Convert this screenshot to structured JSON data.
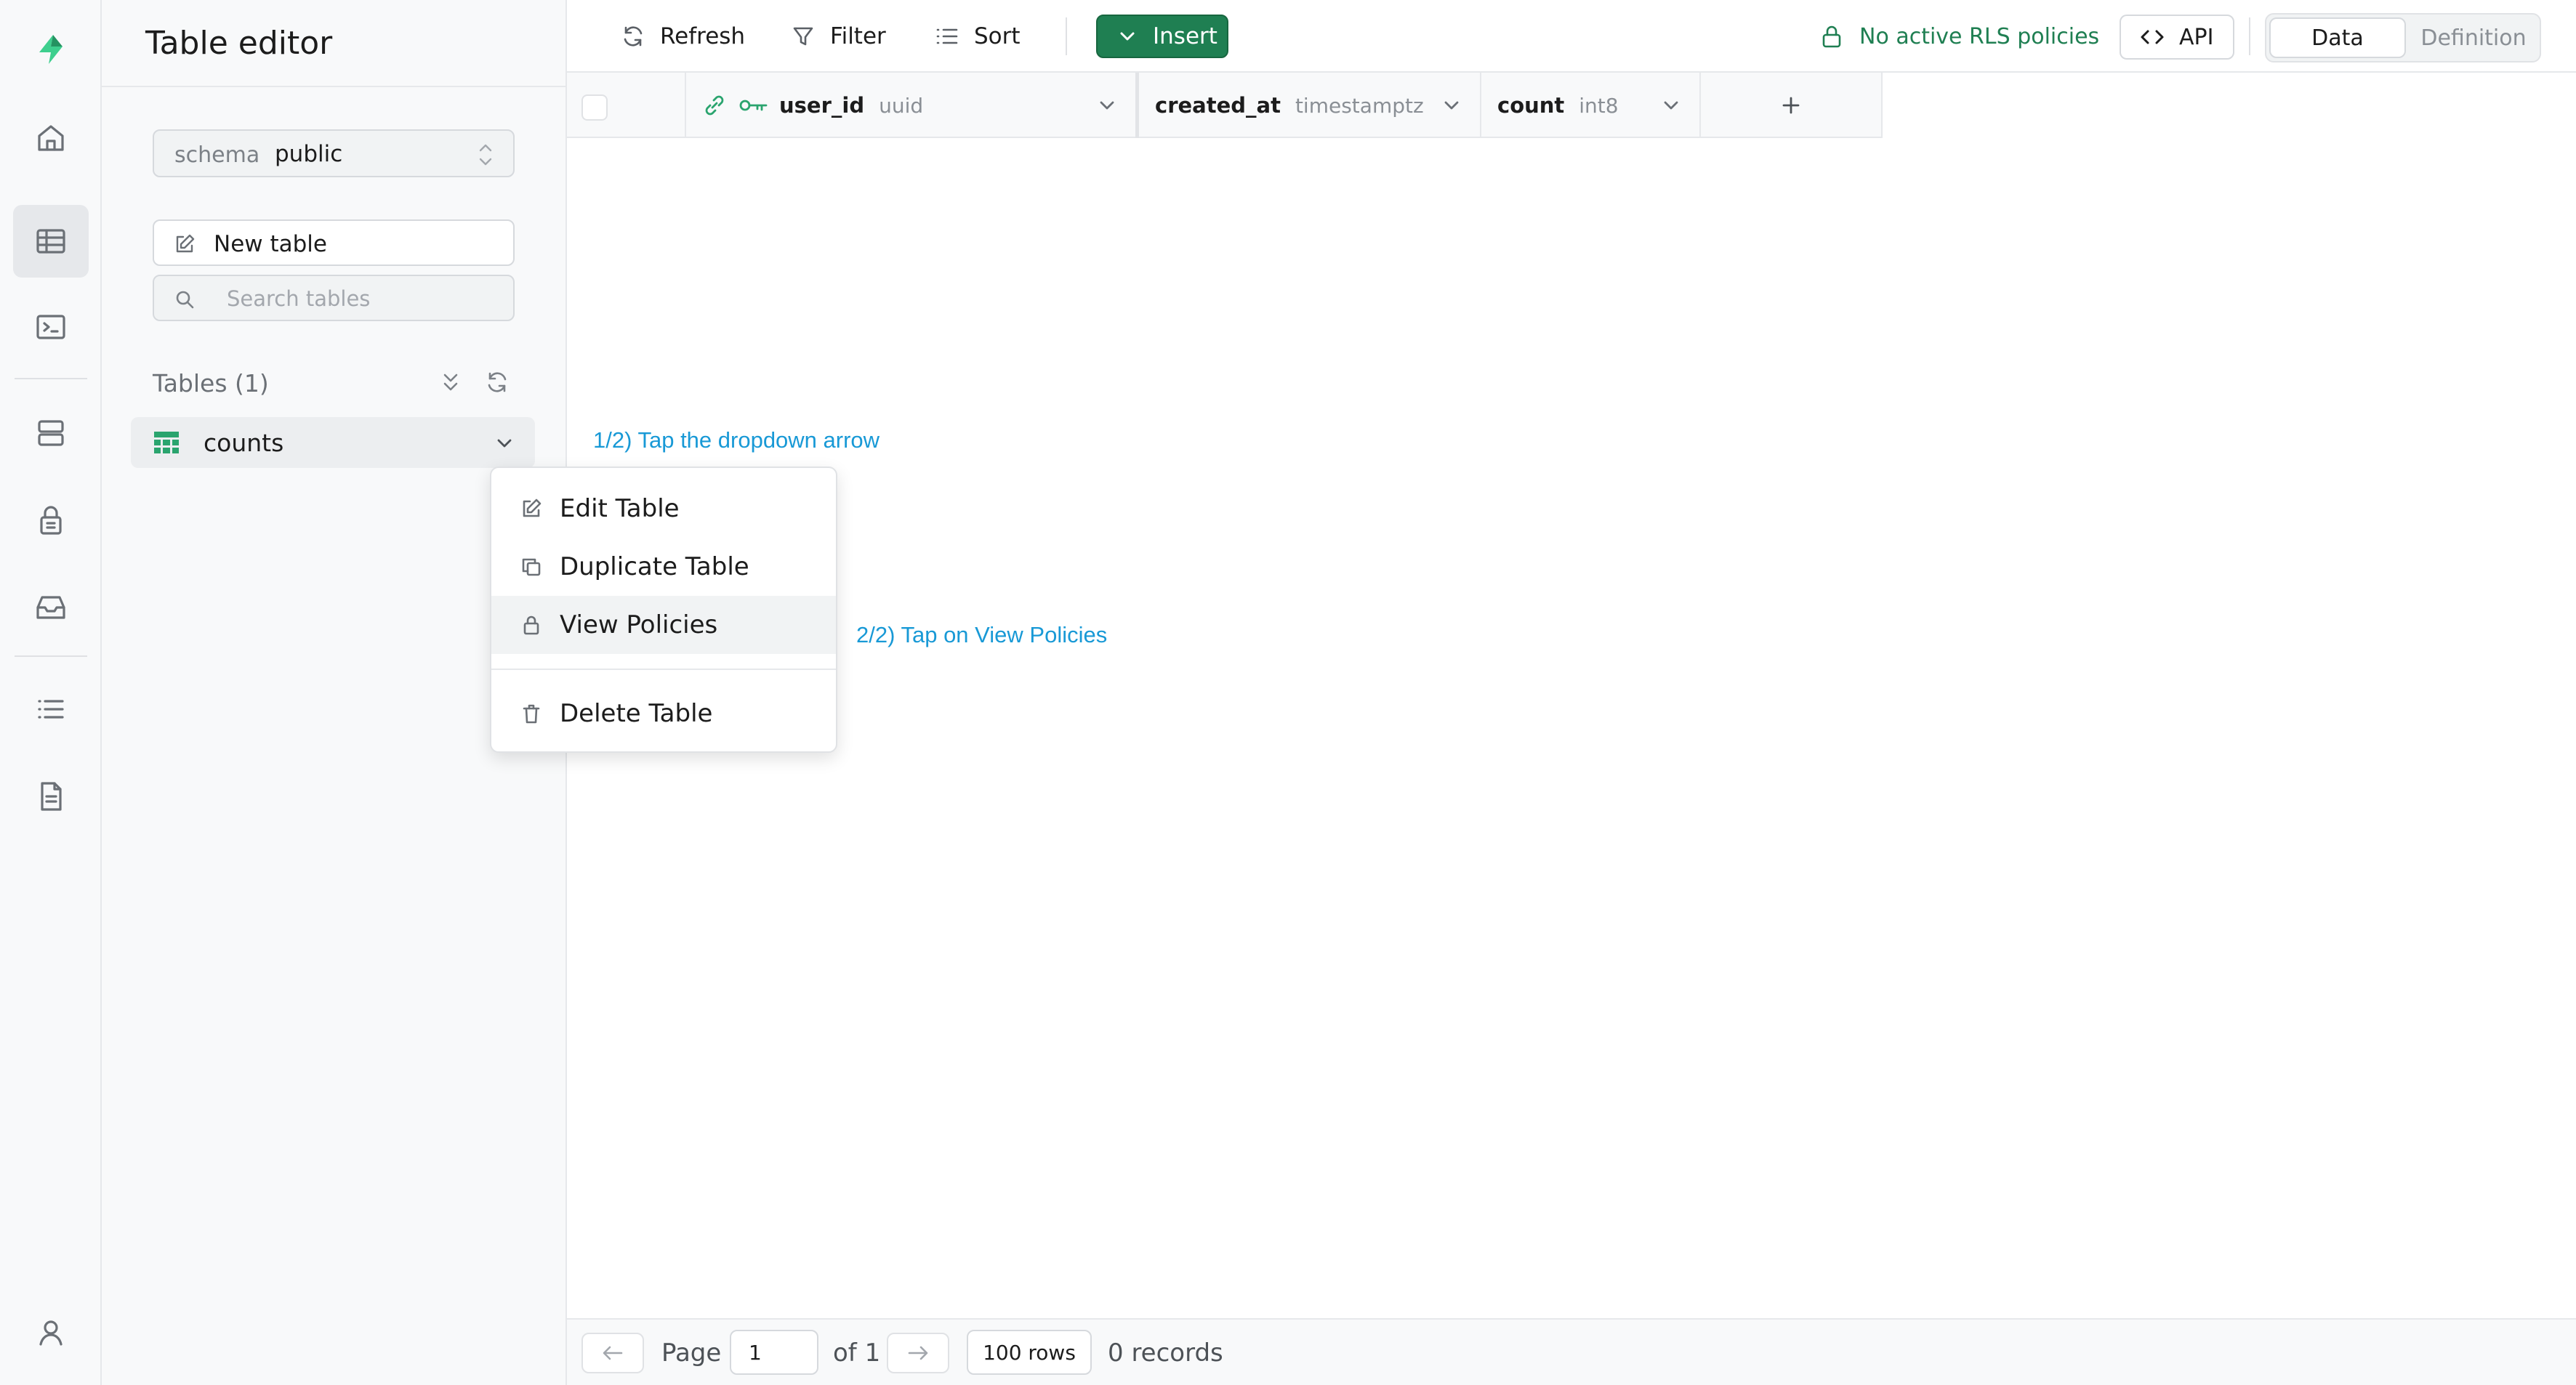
{
  "app": {
    "accent": "#1f7f52",
    "hint_color": "#1899d6"
  },
  "rail": {
    "items": [
      {
        "icon": "supabase-logo-icon"
      },
      {
        "icon": "home-icon"
      },
      {
        "icon": "table-editor-icon",
        "active": true
      },
      {
        "icon": "sql-editor-icon"
      },
      {
        "icon": "database-icon"
      },
      {
        "icon": "auth-lock-icon"
      },
      {
        "icon": "storage-icon"
      },
      {
        "icon": "logs-icon"
      },
      {
        "icon": "docs-icon"
      },
      {
        "icon": "profile-icon"
      }
    ]
  },
  "sidebar": {
    "title": "Table editor",
    "schema_label": "schema",
    "schema_value": "public",
    "new_table_label": "New table",
    "search_placeholder": "Search tables",
    "tables_heading": "Tables (1)",
    "tables": [
      {
        "name": "counts"
      }
    ]
  },
  "toolbar": {
    "refresh_label": "Refresh",
    "filter_label": "Filter",
    "sort_label": "Sort",
    "insert_label": "Insert",
    "rls_status": "No active RLS policies",
    "api_label": "API",
    "view_data_label": "Data",
    "view_definition_label": "Definition"
  },
  "grid": {
    "columns": [
      {
        "name": "user_id",
        "type": "uuid"
      },
      {
        "name": "created_at",
        "type": "timestamptz"
      },
      {
        "name": "count",
        "type": "int8"
      }
    ]
  },
  "hints": {
    "step1": "1/2) Tap the dropdown arrow",
    "step2": "2/2) Tap on View Policies"
  },
  "context_menu": {
    "edit": "Edit Table",
    "duplicate": "Duplicate Table",
    "view_policies": "View Policies",
    "delete": "Delete Table"
  },
  "footer": {
    "page_label": "Page",
    "page_value": "1",
    "page_of": "of 1",
    "rows_per_page": "100 rows",
    "records": "0 records"
  }
}
